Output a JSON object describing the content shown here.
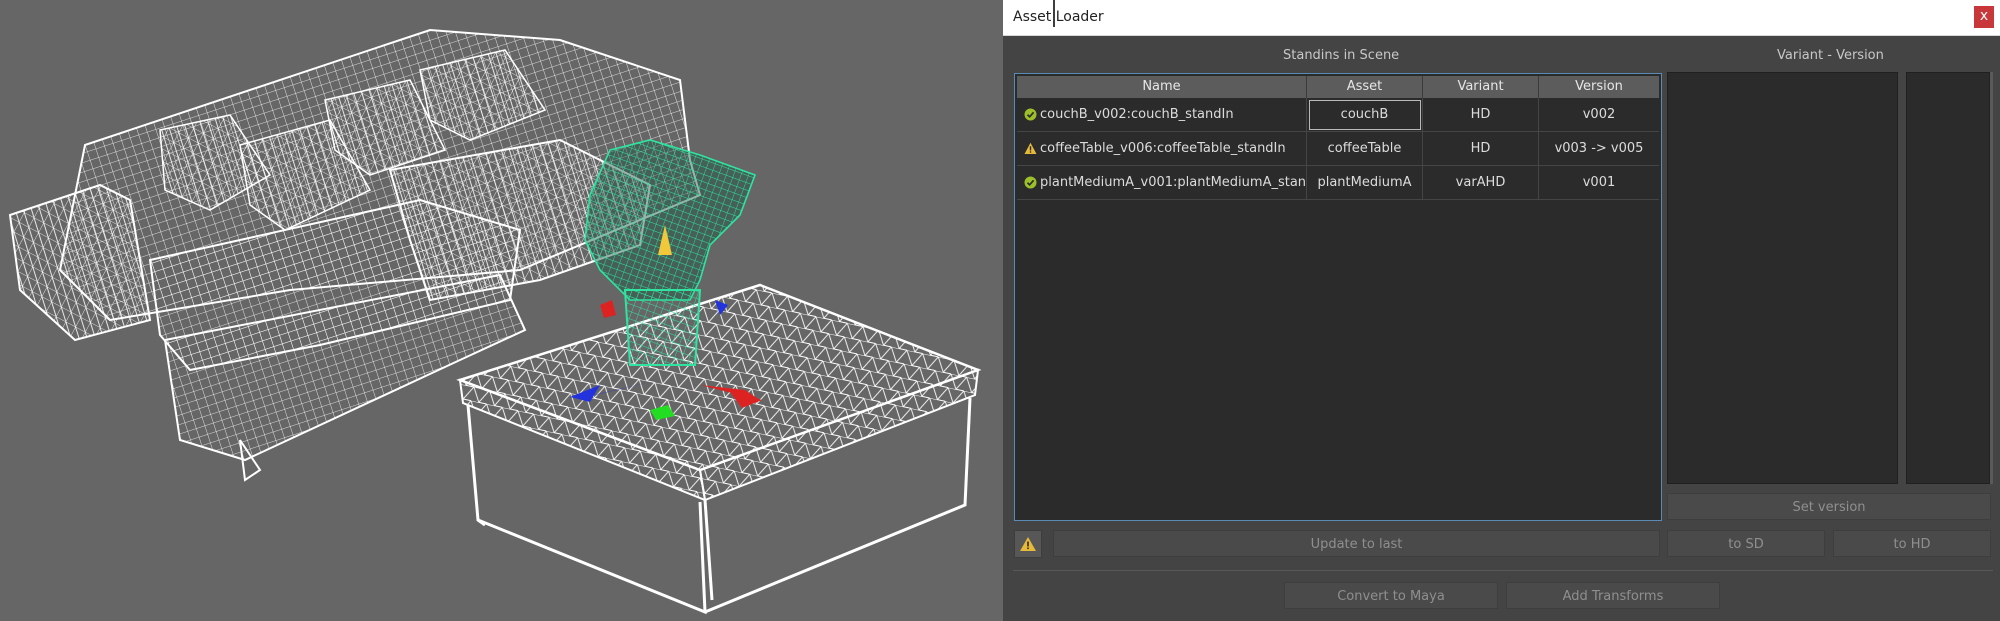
{
  "window": {
    "title": "Asset Loader",
    "close_label": "x"
  },
  "sections": {
    "standins_label": "Standins in Scene",
    "variant_label": "Variant - Version"
  },
  "table": {
    "columns": [
      "Name",
      "Asset",
      "Variant",
      "Version"
    ],
    "rows": [
      {
        "status": "ok",
        "name": "couchB_v002:couchB_standIn",
        "asset": "couchB",
        "variant": "HD",
        "version": "v002"
      },
      {
        "status": "warning",
        "name": "coffeeTable_v006:coffeeTable_standIn",
        "asset": "coffeeTable",
        "variant": "HD",
        "version": "v003 -> v005"
      },
      {
        "status": "ok",
        "name": "plantMediumA_v001:plantMediumA_stan...",
        "asset": "plantMediumA",
        "variant": "varAHD",
        "version": "v001"
      }
    ]
  },
  "buttons": {
    "set_version": "Set version",
    "update_to_last": "Update to last",
    "to_sd": "to SD",
    "to_hd": "to HD",
    "convert_to_maya": "Convert to Maya",
    "add_transforms": "Add Transforms"
  },
  "colors": {
    "ok": "#9cbf2b",
    "warning": "#e7b93a",
    "accent": "#5a8bb4",
    "plant": "#2fe3a0"
  }
}
